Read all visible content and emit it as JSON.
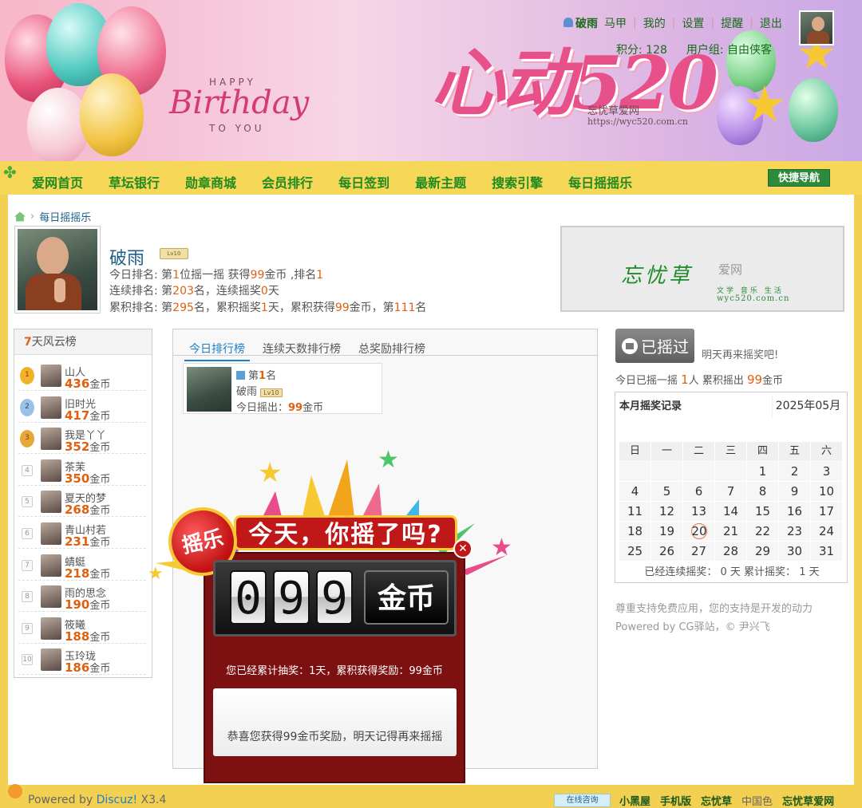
{
  "header": {
    "happy": "HAPPY",
    "birthday": "Birthday",
    "to_you": "TO YOU",
    "logo_text": "心动520",
    "logo_sub": "忘忧草爱网",
    "logo_url": "https://wyc520.com.cn"
  },
  "user_nav": {
    "username": "破雨",
    "items": [
      "马甲",
      "我的",
      "设置",
      "提醒",
      "退出"
    ],
    "points": "积分: 128",
    "usergroup": "用户组: 自由侠客"
  },
  "nav": {
    "items": [
      "爱网首页",
      "草坛银行",
      "勋章商城",
      "会员排行",
      "每日签到",
      "最新主题",
      "搜索引擎",
      "每日摇摇乐"
    ],
    "quick_nav": "快捷导航"
  },
  "breadcrumb": {
    "current": "每日摇摇乐"
  },
  "profile": {
    "name": "破雨",
    "level_badge": "Lv10",
    "line1_pre": "今日排名: 第",
    "line1_rank": "1",
    "line1_mid": "位摇一摇 获得",
    "line1_coins": "99",
    "line1_post": "金币 ,排名",
    "line1_rank2": "1",
    "line2_pre": "连续排名: 第",
    "line2_rank": "203",
    "line2_mid": "名，连续摇奖",
    "line2_days": "0",
    "line2_post": "天",
    "line3_pre": "累积排名: 第",
    "line3_rank": "295",
    "line3_mid": "名，累积摇奖",
    "line3_days": "1",
    "line3_mid2": "天，累积获得",
    "line3_coins": "99",
    "line3_mid3": "金币，第",
    "line3_rank2": "111",
    "line3_post": "名"
  },
  "ad": {
    "brand": "忘忧草",
    "aiwang": "爱网",
    "tags": "文学 音乐 生活",
    "url": "wyc520.com.cn"
  },
  "leaderboard": {
    "title_num": "7",
    "title_rest": "天风云榜",
    "rows": [
      {
        "rank": "1",
        "name": "山人",
        "coins": "436",
        "unit": "金币"
      },
      {
        "rank": "2",
        "name": "旧时光",
        "coins": "417",
        "unit": "金币"
      },
      {
        "rank": "3",
        "name": "我是丫丫",
        "coins": "352",
        "unit": "金币"
      },
      {
        "rank": "4",
        "name": "茶茉",
        "coins": "350",
        "unit": "金币"
      },
      {
        "rank": "5",
        "name": "夏天的梦",
        "coins": "268",
        "unit": "金币"
      },
      {
        "rank": "6",
        "name": "青山村若",
        "coins": "231",
        "unit": "金币"
      },
      {
        "rank": "7",
        "name": "蜻蜓",
        "coins": "218",
        "unit": "金币"
      },
      {
        "rank": "8",
        "name": "雨的思念",
        "coins": "190",
        "unit": "金币"
      },
      {
        "rank": "9",
        "name": "筱曦",
        "coins": "188",
        "unit": "金币"
      },
      {
        "rank": "10",
        "name": "玉玲珑",
        "coins": "186",
        "unit": "金币"
      }
    ]
  },
  "rank_tabs": [
    "今日排行榜",
    "连续天数排行榜",
    "总奖励排行榜"
  ],
  "rank_card": {
    "rank_pre": "第",
    "rank_num": "1",
    "rank_post": "名",
    "name": "破雨",
    "level_badge": "Lv10",
    "today_pre": "今日摇出：",
    "today_coins": "99",
    "today_unit": "金币"
  },
  "popup": {
    "badge": "摇乐",
    "title": "今天，你摇了吗?",
    "digits": [
      "0",
      "9",
      "9"
    ],
    "coin_label": "金币",
    "summary": "您已经累计抽奖：1天，累积获得奖励：99金币",
    "note": "恭喜您获得99金币奖励，明天记得再来摇摇"
  },
  "shake": {
    "button": "已摇过",
    "tomorrow": "明天再来摇奖吧!",
    "today_pre": "今日已摇一摇 ",
    "today_people": "1",
    "today_mid": "人 累积摇出 ",
    "today_coins": "99",
    "today_unit": "金币"
  },
  "calendar": {
    "title": "本月摇奖记录",
    "month": "2025年05月",
    "weekdays": [
      "日",
      "一",
      "二",
      "三",
      "四",
      "五",
      "六"
    ],
    "weeks": [
      [
        "",
        "",
        "",
        "",
        "1",
        "2",
        "3"
      ],
      [
        "4",
        "5",
        "6",
        "7",
        "8",
        "9",
        "10"
      ],
      [
        "11",
        "12",
        "13",
        "14",
        "15",
        "16",
        "17"
      ],
      [
        "18",
        "19",
        "20",
        "21",
        "22",
        "23",
        "24"
      ],
      [
        "25",
        "26",
        "27",
        "28",
        "29",
        "30",
        "31"
      ]
    ],
    "today": "20",
    "footer": "已经连续摇奖：  0 天 累计摇奖：  1 天"
  },
  "support": {
    "line1": "尊重支持免费应用，您的支持是开发的动力",
    "line2": "Powered by CG驿站，© 尹兴飞"
  },
  "footer": {
    "powered_pre": "Powered by ",
    "powered_brand": "Discuz!",
    "powered_ver": " X3.4",
    "consult": "在线咨询",
    "links": [
      "小黑屋",
      "手机版",
      "忘忧草"
    ],
    "china": "中国色",
    "site": "忘忧草爱网"
  },
  "colors": {
    "accent_orange": "#e06010",
    "nav_green": "#1f8a1f",
    "link_blue": "#1d5f8a",
    "page_yellow": "#f4d052"
  }
}
